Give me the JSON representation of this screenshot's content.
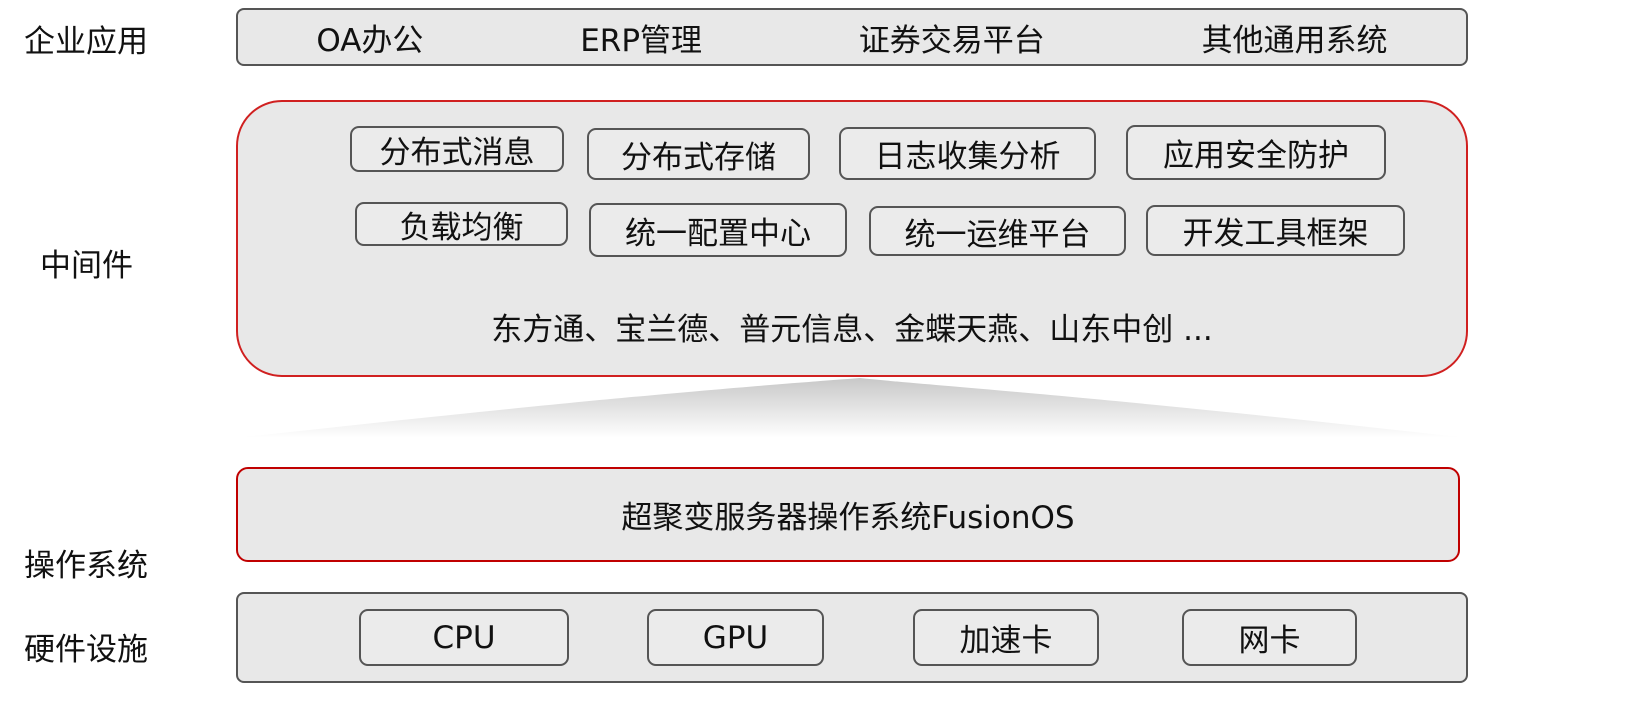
{
  "layers": {
    "enterprise_app": {
      "label": "企业应用",
      "items": [
        "OA办公",
        "ERP管理",
        "证券交易平台",
        "其他通用系统"
      ]
    },
    "middleware": {
      "label": "中间件",
      "row1": [
        "分布式消息",
        "分布式存储",
        "日志收集分析",
        "应用安全防护"
      ],
      "row2": [
        "负载均衡",
        "统一配置中心",
        "统一运维平台",
        "开发工具框架"
      ],
      "vendors": "东方通、宝兰德、普元信息、金蝶天燕、山东中创 ..."
    },
    "os": {
      "label": "操作系统",
      "name": "超聚变服务器操作系统FusionOS"
    },
    "hardware": {
      "label": "硬件设施",
      "items": [
        "CPU",
        "GPU",
        "加速卡",
        "网卡"
      ]
    }
  },
  "colors": {
    "accent_border": "#c00000",
    "box_fill": "#e8e8e8",
    "box_border": "#555555"
  }
}
